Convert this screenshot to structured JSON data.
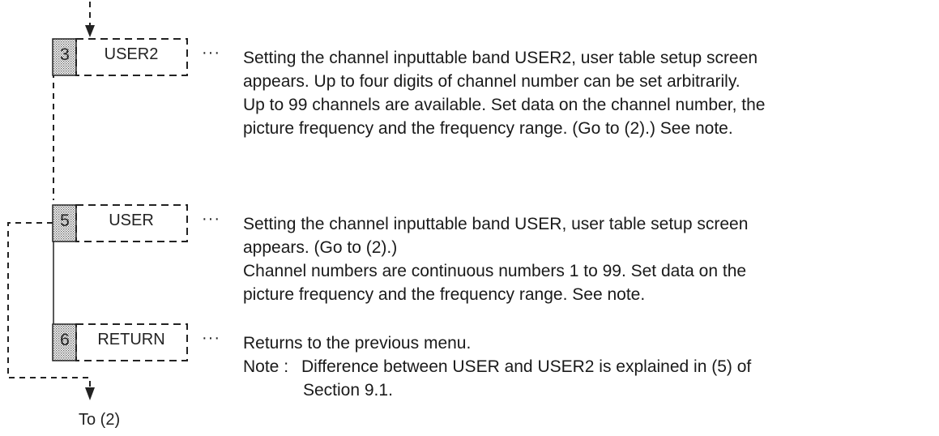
{
  "items": [
    {
      "key_number": "3",
      "label": "USER2",
      "ellipsis": "···",
      "description_lines": [
        "Setting the channel inputtable band USER2, user table setup screen",
        "appears.  Up to four digits of channel number can be set arbitrarily.",
        "Up to 99 channels are available.  Set data on the channel number, the",
        "picture frequency and the frequency range.  (Go to (2).) See note."
      ]
    },
    {
      "key_number": "5",
      "label": "USER",
      "ellipsis": "···",
      "description_lines": [
        "Setting the channel inputtable band USER, user table setup screen",
        "appears.  (Go to (2).)",
        "Channel numbers are continuous numbers 1 to 99.  Set data on the",
        "picture frequency and the frequency range.  See note."
      ]
    },
    {
      "key_number": "6",
      "label": "RETURN",
      "ellipsis": "···",
      "description_lines": [
        "Returns to the previous menu."
      ],
      "note": {
        "head": "Note :",
        "lines": [
          "Difference between USER and USER2 is explained in (5) of",
          "Section 9.1."
        ]
      }
    }
  ],
  "exit_label": "To (2)"
}
